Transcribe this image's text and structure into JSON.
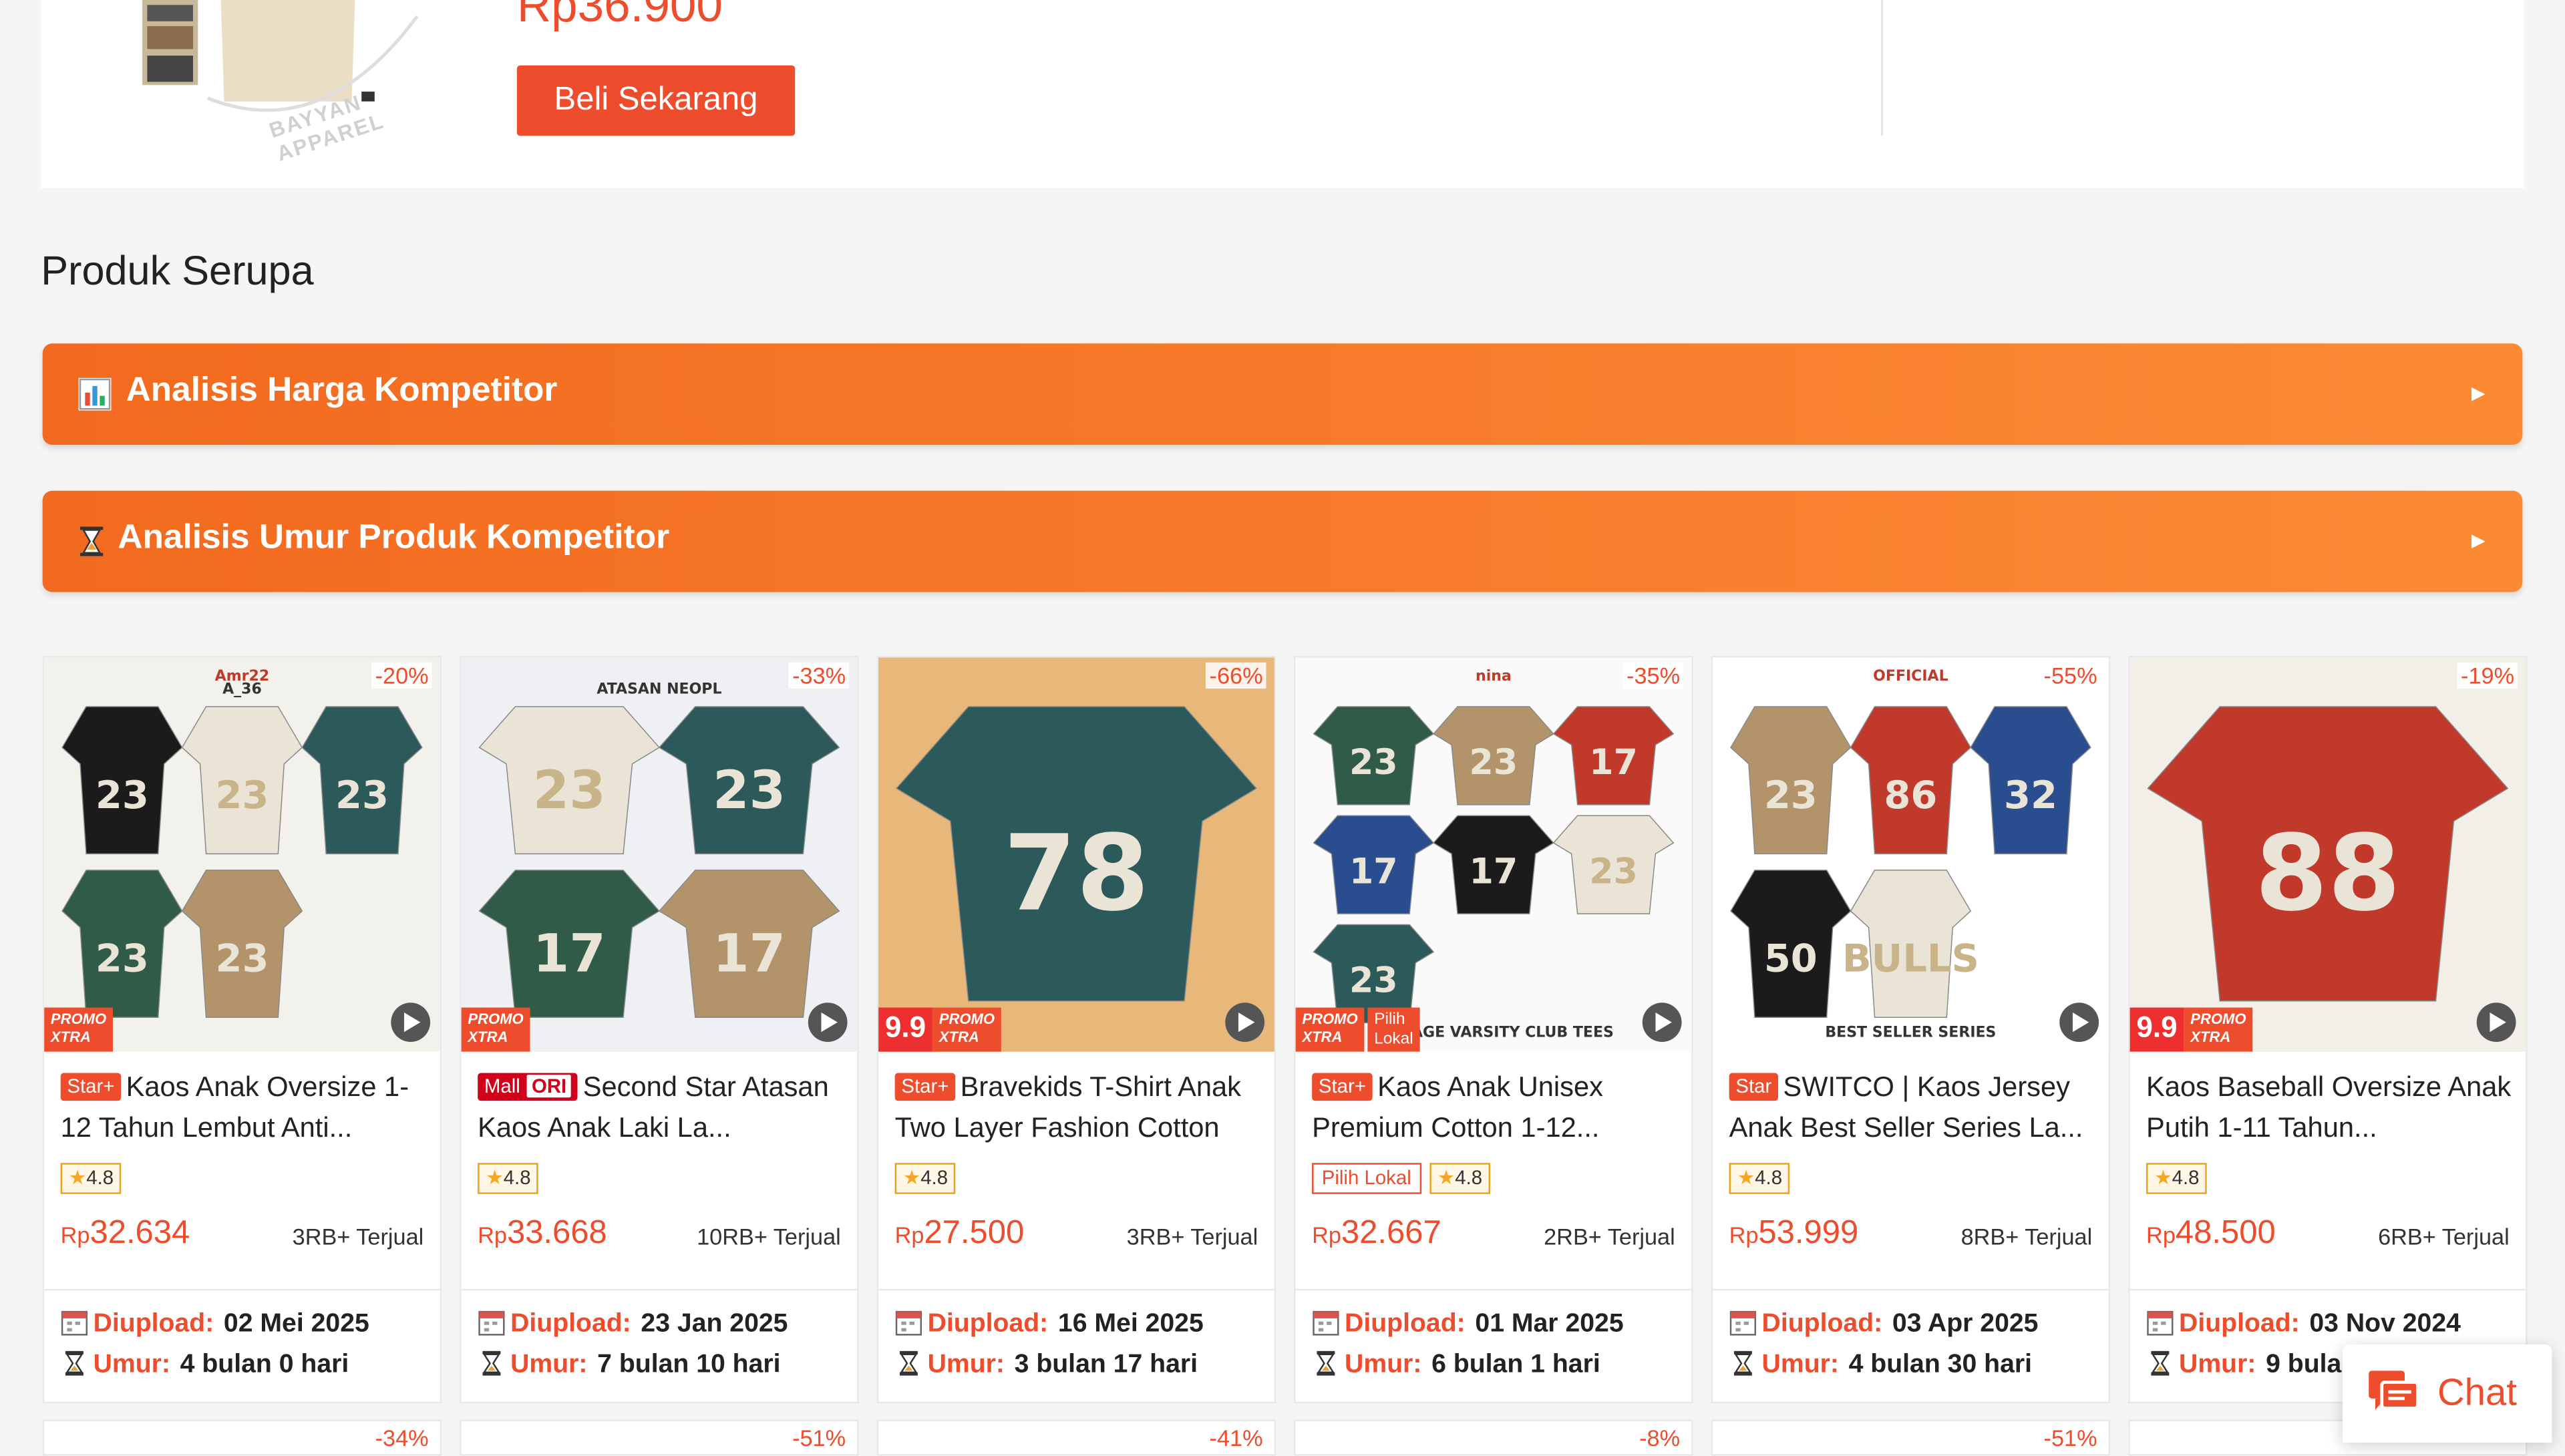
{
  "top_product": {
    "price": "Rp36.900",
    "buy_label": "Beli Sekarang",
    "watermark": "BAYYAN APPAREL"
  },
  "similar_title": "Produk Serupa",
  "accordions": [
    {
      "label": "Analisis Harga Kompetitor",
      "icon": "bar-chart-icon"
    },
    {
      "label": "Analisis Umur Produk Kompetitor",
      "icon": "hourglass-icon"
    }
  ],
  "info_labels": {
    "upload": "Diupload:",
    "age": "Umur:"
  },
  "products": [
    {
      "discount": "-20%",
      "badge": "Star+",
      "badge_type": "star",
      "title": "Kaos Anak Oversize 1-12 Tahun Lembut Anti...",
      "rating": "4.8",
      "lokal": "",
      "currency": "Rp",
      "price": "32.634",
      "sold": "3RB+ Terjual",
      "uploaded": "02 Mei 2025",
      "age": "4 bulan 0 hari",
      "promo": "PROMO XTRA",
      "promo_nine": "",
      "image_text": "A_36",
      "image_brand": "Amr22",
      "jersey_numbers": [
        "23",
        "23",
        "23",
        "23",
        "23"
      ],
      "bg": "#f3f1ec"
    },
    {
      "discount": "-33%",
      "badge": "Mall",
      "badge_type": "mall",
      "badge_extra": "ORI",
      "title": "Second Star Atasan Kaos Anak Laki La...",
      "rating": "4.8",
      "lokal": "",
      "currency": "Rp",
      "price": "33.668",
      "sold": "10RB+ Terjual",
      "uploaded": "23 Jan 2025",
      "age": "7 bulan 10 hari",
      "promo": "PROMO XTRA",
      "promo_nine": "",
      "image_text": "ATASAN NEOPL",
      "image_brand": "",
      "jersey_numbers": [
        "23",
        "23",
        "17",
        "17"
      ],
      "bg": "#eef0f4"
    },
    {
      "discount": "-66%",
      "badge": "Star+",
      "badge_type": "star",
      "title": "Bravekids T-Shirt Anak Two Layer Fashion Cotton",
      "rating": "4.8",
      "lokal": "",
      "currency": "Rp",
      "price": "27.500",
      "sold": "3RB+ Terjual",
      "uploaded": "16 Mei 2025",
      "age": "3 bulan 17 hari",
      "promo": "PROMO XTRA",
      "promo_nine": "9.9",
      "image_text": "",
      "image_brand": "",
      "jersey_numbers": [
        "78"
      ],
      "bg": "#e8b77a"
    },
    {
      "discount": "-35%",
      "badge": "Star+",
      "badge_type": "star",
      "title": "Kaos Anak Unisex Premium Cotton 1-12...",
      "rating": "4.8",
      "lokal": "Pilih Lokal",
      "currency": "Rp",
      "price": "32.667",
      "sold": "2RB+ Terjual",
      "uploaded": "01 Mar 2025",
      "age": "6 bulan 1 hari",
      "promo": "PROMO XTRA",
      "promo_nine": "",
      "promo_lokal": "Pilih Lokal",
      "image_text": "VINTAGE VARSITY CLUB TEES",
      "image_brand": "nina",
      "jersey_numbers": [
        "23",
        "23",
        "17",
        "17",
        "17",
        "23",
        "23"
      ],
      "bg": "#fafafa"
    },
    {
      "discount": "-55%",
      "badge": "Star",
      "badge_type": "star",
      "title": "SWITCO | Kaos Jersey Anak Best Seller Series La...",
      "rating": "4.8",
      "lokal": "",
      "currency": "Rp",
      "price": "53.999",
      "sold": "8RB+ Terjual",
      "uploaded": "03 Apr 2025",
      "age": "4 bulan 30 hari",
      "promo": "",
      "promo_nine": "",
      "image_text": "BEST SELLER SERIES",
      "image_brand": "OFFICIAL",
      "jersey_numbers": [
        "23",
        "86",
        "32",
        "50",
        "BULLS"
      ],
      "bg": "#ffffff"
    },
    {
      "discount": "-19%",
      "badge": "",
      "badge_type": "",
      "title": "Kaos Baseball Oversize Anak Putih 1-11 Tahun...",
      "rating": "4.8",
      "lokal": "",
      "currency": "Rp",
      "price": "48.500",
      "sold": "6RB+ Terjual",
      "uploaded": "03 Nov 2024",
      "age": "9 bulan",
      "promo": "PROMO XTRA",
      "promo_nine": "9.9",
      "image_text": "",
      "image_brand": "",
      "jersey_numbers": [
        "88"
      ],
      "bg": "#f2efe9"
    }
  ],
  "next_row_discounts": [
    "-34%",
    "-51%",
    "-41%",
    "-8%",
    "-51%",
    ""
  ],
  "chat": {
    "label": "Chat"
  },
  "colors": {
    "accent": "#ee4d2d",
    "accordion": "#f47a28"
  }
}
